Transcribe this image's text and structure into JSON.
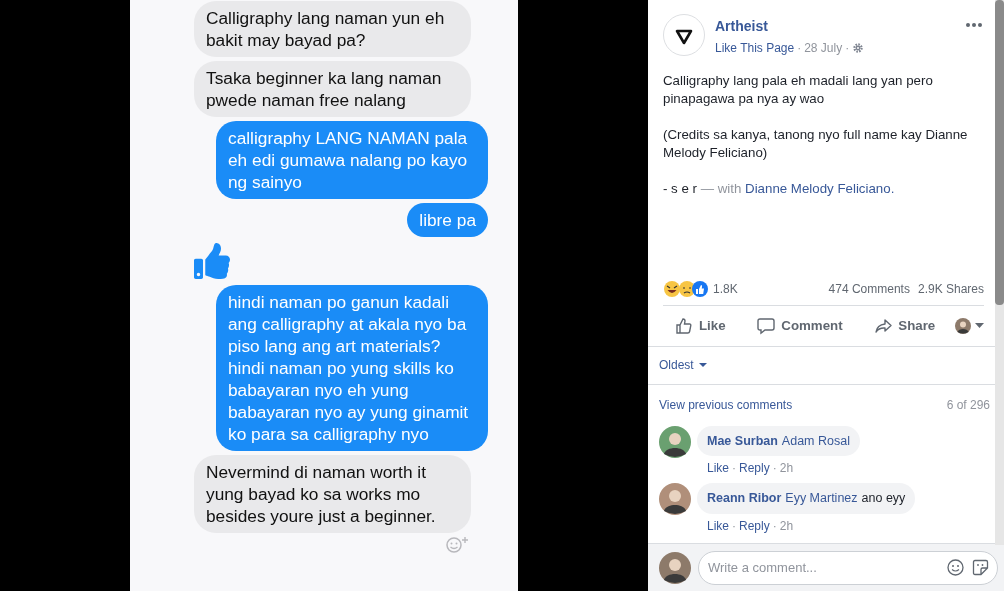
{
  "photo": {
    "messages": [
      {
        "kind": "received",
        "text": "Calligraphy lang naman yun eh bakit may bayad pa?"
      },
      {
        "kind": "received",
        "text": "Tsaka beginner ka lang naman pwede naman free nalang"
      },
      {
        "kind": "sent",
        "text": "calligraphy LANG NAMAN pala eh edi gumawa nalang po kayo ng sainyo"
      },
      {
        "kind": "sent",
        "text": "libre pa"
      },
      {
        "kind": "like"
      },
      {
        "kind": "sent",
        "text": "hindi naman po ganun kadali ang calligraphy at akala nyo ba piso lang ang art materials? hindi naman po yung skills ko babayaran nyo eh yung babayaran nyo ay yung ginamit ko para sa calligraphy nyo"
      },
      {
        "kind": "received",
        "text": "Nevermind di naman worth it yung bayad ko sa works mo besides youre just a beginner.",
        "reaction_button": true
      }
    ]
  },
  "post": {
    "separator": "·",
    "page_name": "Artheist",
    "like_link": "Like This Page",
    "date": "28 July",
    "paragraphs": [
      "Calligraphy lang pala eh madali lang yan pero pinapagawa pa nya ay wao",
      "(Credits sa kanya, tanong nyo full name kay Dianne Melody Feliciano)"
    ],
    "signature": "- s e r",
    "with_text": "— with",
    "tagged": "Dianne Melody Feliciano.",
    "reactions_count": "1.8K",
    "comments_count": "474 Comments",
    "shares_count": "2.9K Shares",
    "actions": [
      "Like",
      "Comment",
      "Share"
    ]
  },
  "comments": {
    "separator": "·",
    "sort": "Oldest",
    "view_previous": "View previous comments",
    "counter": "6 of 296",
    "items": [
      {
        "author": "Mae Surban",
        "mention": "Adam Rosal",
        "actions": [
          "Like",
          "Reply"
        ],
        "time": "2h"
      },
      {
        "author": "Reann Ribor",
        "mention": "Eyy Martinez",
        "text": "ano eyy",
        "actions": [
          "Like",
          "Reply"
        ],
        "time": "2h"
      }
    ],
    "placeholder": "Write a comment..."
  }
}
